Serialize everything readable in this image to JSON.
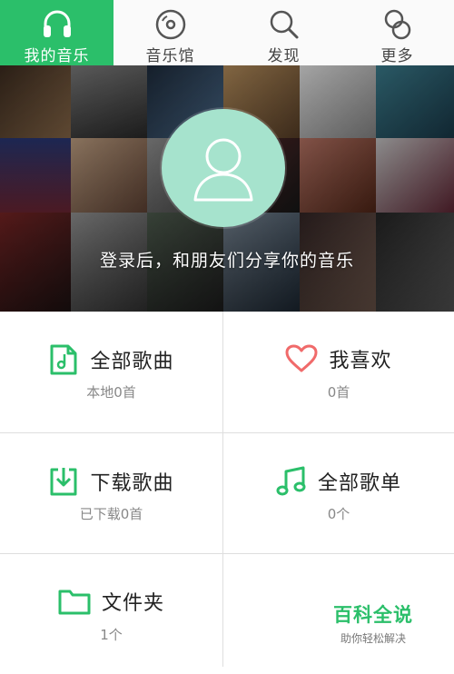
{
  "tabs": [
    {
      "label": "我的音乐",
      "icon": "headphones-icon",
      "active": true
    },
    {
      "label": "音乐馆",
      "icon": "vinyl-disc-icon",
      "active": false
    },
    {
      "label": "发现",
      "icon": "search-icon",
      "active": false
    },
    {
      "label": "更多",
      "icon": "more-circles-icon",
      "active": false
    }
  ],
  "hero": {
    "login_tip": "登录后，和朋友们分享你的音乐"
  },
  "grid": [
    {
      "title": "全部歌曲",
      "sub": "本地0首",
      "icon": "music-file-icon"
    },
    {
      "title": "我喜欢",
      "sub": "0首",
      "icon": "heart-icon"
    },
    {
      "title": "下载歌曲",
      "sub": "已下载0首",
      "icon": "download-icon"
    },
    {
      "title": "全部歌单",
      "sub": "0个",
      "icon": "music-note-icon"
    },
    {
      "title": "文件夹",
      "sub": "1个",
      "icon": "folder-icon"
    }
  ],
  "watermark": {
    "title": "百科全说",
    "sub": "助你轻松解决"
  },
  "colors": {
    "accent": "#2bbf6a",
    "heart": "#f06a6a",
    "avatar_bg": "#a6e3cd"
  }
}
